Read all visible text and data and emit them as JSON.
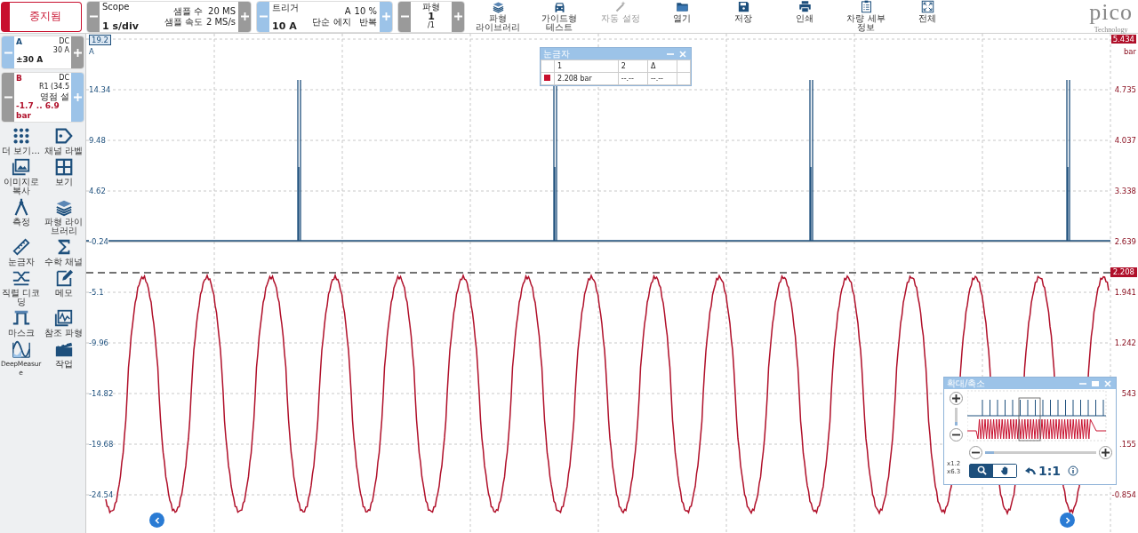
{
  "status_button": {
    "label": "중지됨"
  },
  "timebase": {
    "title": "Scope",
    "value": "1 s/div",
    "info": [
      "샘플 수",
      "20 MS",
      "샘플 속도",
      "2 MS/s"
    ]
  },
  "trigger": {
    "title": "트리거",
    "value": "10 A",
    "info": [
      "A",
      "10 %",
      "단순 에지",
      "반복"
    ]
  },
  "waveform_counter": {
    "title": "파형",
    "value": "1",
    "total": "/1"
  },
  "toolbar": [
    {
      "label": "파형 라이브러리",
      "kind": "books",
      "disabled": false
    },
    {
      "label": "가이드형 테스트",
      "kind": "car",
      "disabled": false
    },
    {
      "label": "자동 설정",
      "kind": "wand",
      "disabled": true
    },
    {
      "label": "열기",
      "kind": "folder",
      "disabled": false
    },
    {
      "label": "저장",
      "kind": "disk",
      "disabled": false
    },
    {
      "label": "인쇄",
      "kind": "printer",
      "disabled": false
    },
    {
      "label": "차량 세부 정보",
      "kind": "clipboard",
      "disabled": false
    },
    {
      "label": "전체",
      "kind": "expand",
      "disabled": false
    }
  ],
  "logo": {
    "text": "pico",
    "subtitle": "Technology"
  },
  "channels": [
    {
      "name": "A",
      "color": "#1d4f7c",
      "coupling": "DC",
      "info": [
        "30 A"
      ],
      "range": "±30 A"
    },
    {
      "name": "B",
      "color": "#b0102a",
      "coupling": "DC",
      "info": [
        "R1 (34.5",
        "영점 설"
      ],
      "range": "-1.7 .. 6.9",
      "unit": "bar"
    }
  ],
  "tools": [
    {
      "label": "더 보기...",
      "kind": "dots"
    },
    {
      "label": "채널 라벨",
      "kind": "tag"
    },
    {
      "label": "이미지로 복사",
      "kind": "image"
    },
    {
      "label": "보기",
      "kind": "grid"
    },
    {
      "label": "측정",
      "kind": "compass"
    },
    {
      "label": "파형 라이브러리",
      "kind": "books"
    },
    {
      "label": "눈금자",
      "kind": "ruler"
    },
    {
      "label": "수학 채널",
      "kind": "sigma"
    },
    {
      "label": "직렬 디코딩",
      "kind": "crossing"
    },
    {
      "label": "메모",
      "kind": "note"
    },
    {
      "label": "마스크",
      "kind": "pulse"
    },
    {
      "label": "참조 파형",
      "kind": "chart"
    },
    {
      "label": "DeepMeasure",
      "kind": "wave"
    },
    {
      "label": "작업",
      "kind": "clapper"
    }
  ],
  "axis_left": {
    "unit": "A",
    "ticks": [
      "19.2",
      "14.34",
      "9.48",
      "4.62",
      "-0.24",
      "-5.1",
      "-9.96",
      "-14.82",
      "-19.68",
      "-24.54"
    ]
  },
  "axis_right": {
    "unit": "bar",
    "ticks": [
      "5.434",
      "4.735",
      "4.037",
      "3.338",
      "2.639",
      "1.941",
      "1.242",
      "543",
      ".155",
      "-0.854"
    ]
  },
  "reference_marker": {
    "label": "2.208"
  },
  "ruler_panel": {
    "title": "눈금자",
    "columns": [
      "1",
      "2",
      "Δ"
    ],
    "rows": [
      {
        "color": "#c8102e",
        "cells": [
          "2.208 bar",
          "--.--",
          "--.--"
        ]
      }
    ]
  },
  "zoom_panel": {
    "title": "확대/축소",
    "zoom_x": "x1.2",
    "zoom_y": "x6.3",
    "vertical_slider": {
      "level": 0.2
    },
    "horizontal_slider": {
      "level": 0.08
    },
    "tools": [
      {
        "kind": "zoom",
        "selected": true
      },
      {
        "kind": "pan",
        "selected": false
      }
    ],
    "reset_label": "1:1"
  }
}
